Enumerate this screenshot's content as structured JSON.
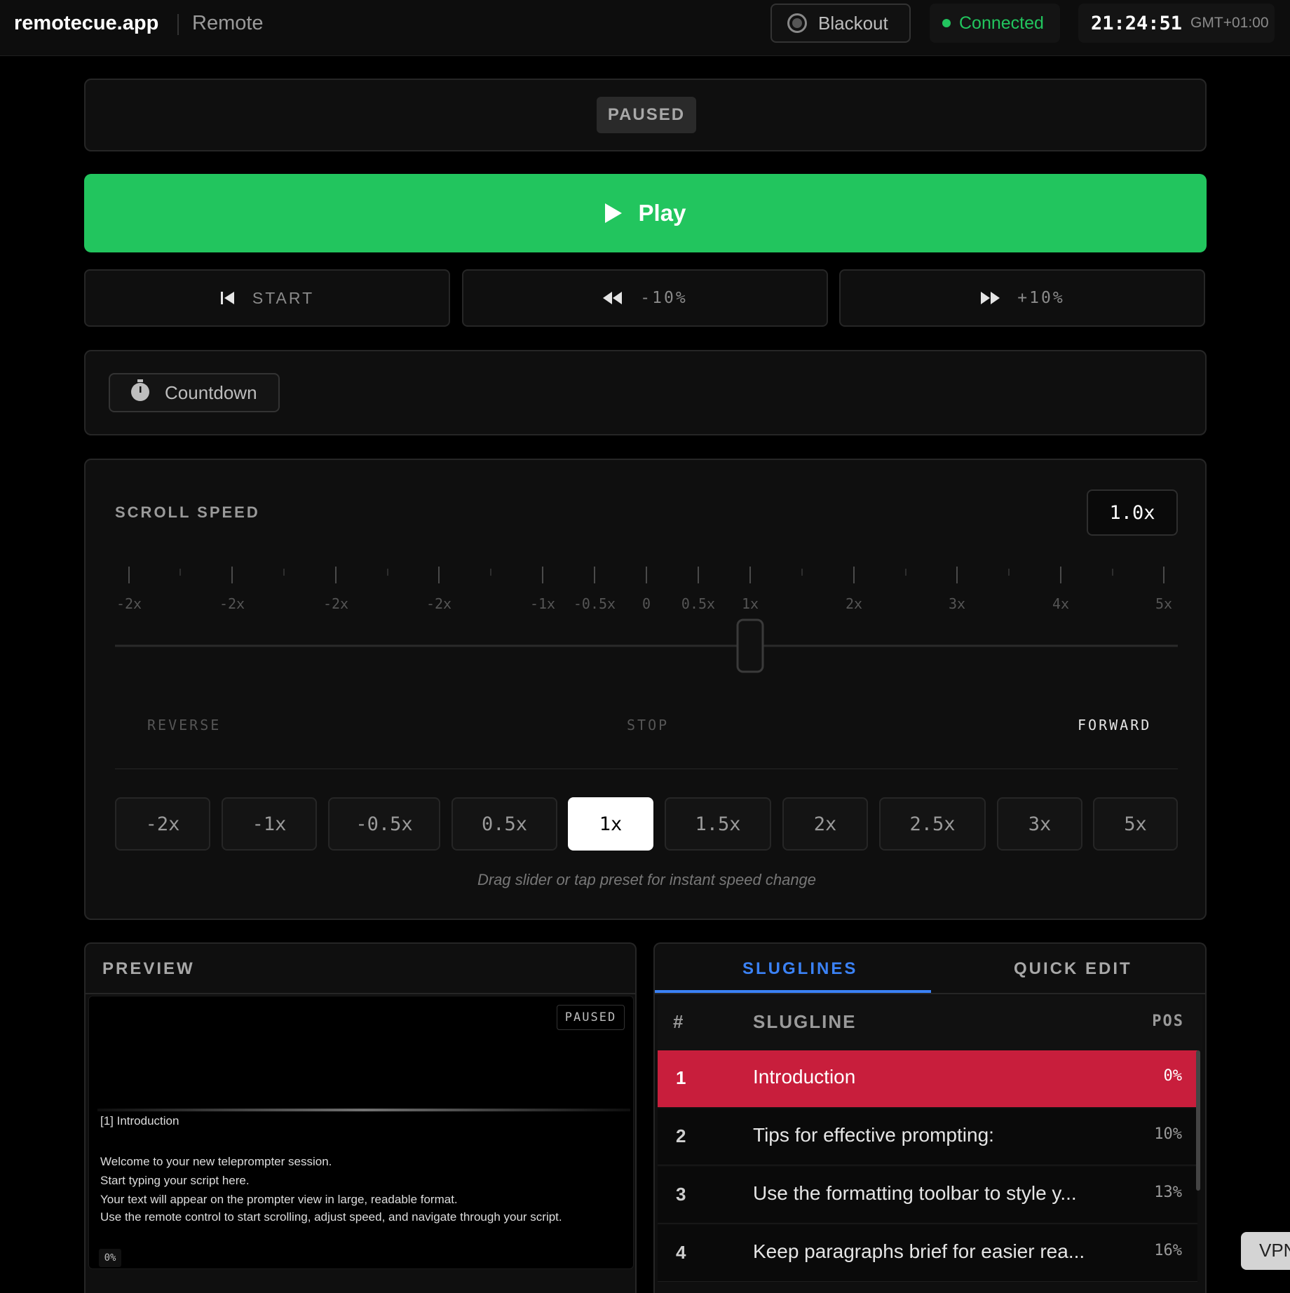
{
  "header": {
    "brand": "remotecue.app",
    "subtitle": "Remote",
    "blackout_label": "Blackout",
    "connection_status": "Connected",
    "clock": "21:24:51",
    "timezone": "GMT+01:00"
  },
  "status": {
    "state": "PAUSED"
  },
  "controls": {
    "play_label": "Play",
    "start_label": "START",
    "back_label": "-10%",
    "forward_label": "+10%",
    "countdown_label": "Countdown"
  },
  "speed": {
    "label": "SCROLL SPEED",
    "value": "1.0x",
    "current": 1,
    "tick_labels": [
      "-2x",
      "-2x",
      "-2x",
      "-2x",
      "-1x",
      "-0.5x",
      "0",
      "0.5x",
      "1x",
      "2x",
      "3x",
      "4x",
      "5x"
    ],
    "reverse_label": "REVERSE",
    "stop_label": "STOP",
    "forward_label": "FORWARD",
    "presets": [
      "-2x",
      "-1x",
      "-0.5x",
      "0.5x",
      "1x",
      "1.5x",
      "2x",
      "2.5x",
      "3x",
      "5x"
    ],
    "active_preset": "1x",
    "hint": "Drag slider or tap preset for instant speed change"
  },
  "preview": {
    "title": "PREVIEW",
    "badge": "PAUSED",
    "slugline": "[1] Introduction",
    "lines": [
      "Welcome to your new teleprompter session.",
      "Start typing your script here.",
      "Your text will appear on the prompter view in large, readable format.",
      "Use the remote control to start scrolling, adjust speed, and navigate through your script."
    ],
    "position": "0%"
  },
  "sluglines": {
    "tabs": [
      "SLUGLINES",
      "QUICK EDIT"
    ],
    "active_tab": "SLUGLINES",
    "columns": [
      "#",
      "SLUGLINE",
      "POS"
    ],
    "rows": [
      {
        "num": "1",
        "title": "Introduction",
        "pos": "0%"
      },
      {
        "num": "2",
        "title": "Tips for effective prompting:",
        "pos": "10%"
      },
      {
        "num": "3",
        "title": "Use the formatting toolbar to style y...",
        "pos": "13%"
      },
      {
        "num": "4",
        "title": "Keep paragraphs brief for easier rea...",
        "pos": "16%"
      }
    ],
    "active_row": 0
  },
  "overlay": {
    "vpn_label": "VPN"
  },
  "colors": {
    "accent_green": "#22c55e",
    "accent_blue": "#3b82f6",
    "active_row": "#c81e3c"
  }
}
